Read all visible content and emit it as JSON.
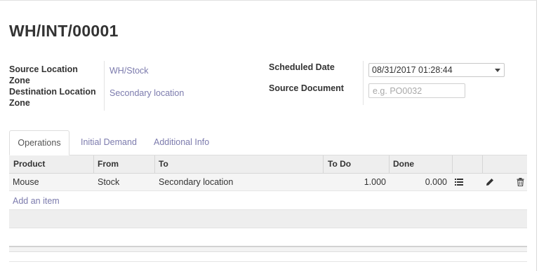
{
  "record": {
    "title": "WH/INT/00001"
  },
  "fields": {
    "source_location_label": "Source Location Zone",
    "source_location_value": "WH/Stock",
    "destination_location_label": "Destination Location Zone",
    "destination_location_value": "Secondary location",
    "scheduled_date_label": "Scheduled Date",
    "scheduled_date_value": "08/31/2017 01:28:44",
    "source_document_label": "Source Document",
    "source_document_placeholder": "e.g. PO0032"
  },
  "tabs": [
    {
      "label": "Operations",
      "active": true
    },
    {
      "label": "Initial Demand",
      "active": false
    },
    {
      "label": "Additional Info",
      "active": false
    }
  ],
  "table": {
    "columns": [
      "Product",
      "From",
      "To",
      "To Do",
      "Done"
    ],
    "rows": [
      {
        "product": "Mouse",
        "from": "Stock",
        "to": "Secondary location",
        "todo": "1.000",
        "done": "0.000",
        "icons": [
          "list-icon",
          "pencil-icon",
          "trash-icon"
        ]
      }
    ],
    "add_item_label": "Add an item"
  },
  "colors": {
    "link": "#7c7bad",
    "header_bg": "#eeeeee",
    "row_bg": "#f5f5f5"
  }
}
